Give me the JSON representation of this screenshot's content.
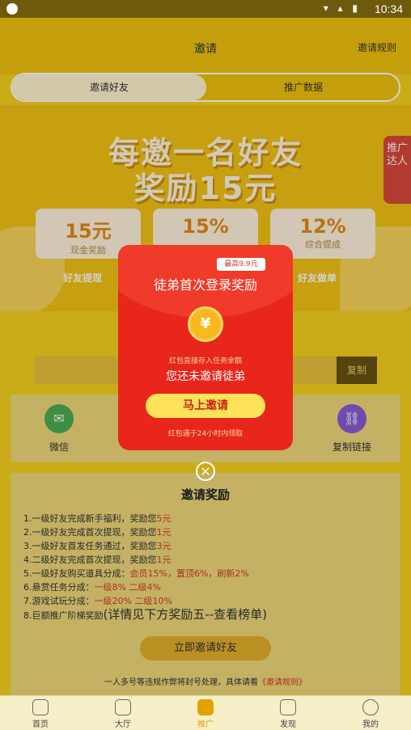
{
  "status_bar": {
    "time": "10:34",
    "icons": "▾ ▴ ▮"
  },
  "header": {
    "title": "邀请",
    "rules": "邀请规则"
  },
  "tabs": [
    {
      "label": "邀请好友"
    },
    {
      "label": "推广数据"
    }
  ],
  "hero": {
    "line1": "每邀一名好友",
    "line2": "奖励15元",
    "cards": [
      {
        "value": "15元",
        "label": "现金奖励"
      },
      {
        "value": "15%",
        "label": ""
      },
      {
        "value": "12%",
        "label": "综合提成"
      }
    ],
    "strip": [
      "好友提现",
      "好友做单"
    ]
  },
  "side_tag": "推广达人",
  "copy_button": "复制",
  "share": [
    {
      "label": "微信",
      "icon": "wechat-icon",
      "color": "#4caf50",
      "glyph": "✉"
    },
    {
      "label": "复制链接",
      "icon": "link-icon",
      "color": "#8a5bd6",
      "glyph": "⛓"
    }
  ],
  "reward": {
    "title": "邀请奖励",
    "items": [
      {
        "text": "1.一级好友完成新手福利，奖励您",
        "hl": "5元"
      },
      {
        "text": "2.一级好友完成首次提现，奖励您",
        "hl": "1元"
      },
      {
        "text": "3.一级好友首发任务通过，奖励您",
        "hl": "3元"
      },
      {
        "text": "4.二级好友完成首次提现，奖励您",
        "hl": "1元"
      },
      {
        "text": "5.一级好友购买道具分成：",
        "hl": "会员15%，置顶6%，刷新2%"
      },
      {
        "text": "6.悬赏任务分成：",
        "hl": "一级8% 二级4%"
      },
      {
        "text": "7.游戏试玩分成：",
        "hl": "一级20% 二级10%"
      }
    ],
    "item8_prefix": "8.巨额推广阶梯奖励",
    "item8_main": "(详情见下方奖励五--查看榜单)",
    "invite_button": "立即邀请好友",
    "note_prefix": "一人多号等违规作弊将封号处理，具体请看",
    "note_link": "《邀请规则》"
  },
  "popup": {
    "badge": "最高9.9元",
    "title": "徒弟首次登录奖励",
    "coin": "¥",
    "small_note": "红包直接存入任务余额",
    "status": "您还未邀请徒弟",
    "button": "马上邀请",
    "expire": "红包遇于24小时内领取",
    "close": "×"
  },
  "bottom_nav": [
    {
      "label": "首页",
      "icon": "home-icon"
    },
    {
      "label": "大厅",
      "icon": "grid-icon"
    },
    {
      "label": "推广",
      "icon": "gift-icon"
    },
    {
      "label": "发现",
      "icon": "compass-icon"
    },
    {
      "label": "我的",
      "icon": "user-icon"
    }
  ]
}
